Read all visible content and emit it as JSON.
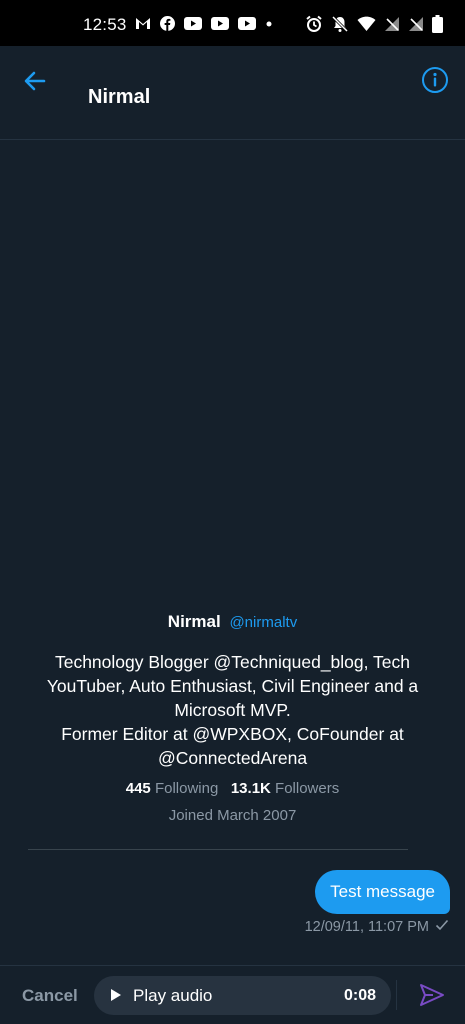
{
  "status_bar": {
    "time": "12:53",
    "left_icons": [
      "gmail-icon",
      "facebook-icon",
      "youtube-icon",
      "youtube-icon",
      "youtube-icon",
      "dot-icon"
    ],
    "right_icons": [
      "alarm-icon",
      "bell-off-icon",
      "wifi-icon",
      "signal-off-icon",
      "signal-off-icon",
      "battery-icon"
    ]
  },
  "header": {
    "title": "Nirmal",
    "back_icon": "back-arrow-icon",
    "info_icon": "info-icon"
  },
  "profile": {
    "name": "Nirmal",
    "handle": "@nirmaltv",
    "bio_line1": "Technology Blogger @Techniqued_blog, Tech YouTuber, Auto Enthusiast, Civil Engineer and a Microsoft MVP.",
    "bio_line2": "Former Editor at @WPXBOX, CoFounder at @ConnectedArena",
    "following_count": "445",
    "following_label": "Following",
    "followers_count": "13.1K",
    "followers_label": "Followers",
    "joined": "Joined March 2007"
  },
  "message": {
    "text": "Test message",
    "timestamp": "12/09/11, 11:07 PM",
    "status_icon": "checkmark-icon"
  },
  "composer": {
    "cancel_label": "Cancel",
    "play_label": "Play audio",
    "duration": "0:08",
    "send_icon": "send-icon"
  },
  "colors": {
    "background": "#15202b",
    "accent": "#1d9bf0",
    "muted": "#8b98a5",
    "send": "#794bc4"
  }
}
